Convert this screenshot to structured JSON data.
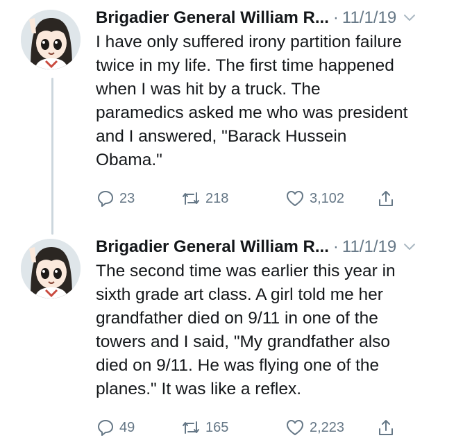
{
  "tweets": [
    {
      "author": "Brigadier General William R...",
      "separator": "·",
      "date": "11/1/19",
      "text": "I have only suffered irony partition failure\ntwice in my life. The first time happened\nwhen I was hit by a truck. The\nparamedics asked me who was president\nand I answered, \"Barack Hussein\nObama.\"",
      "replies": "23",
      "retweets": "218",
      "likes": "3,102"
    },
    {
      "author": "Brigadier General William R...",
      "separator": "·",
      "date": "11/1/19",
      "text": "The second time was earlier this year in\nsixth grade art class. A girl told me her\ngrandfather died on 9/11 in one of the\ntowers and I said, \"My grandfather also\ndied on 9/11. He was flying one of the\nplanes.\" It was like a reflex.",
      "replies": "49",
      "retweets": "165",
      "likes": "2,223"
    }
  ],
  "icons": {
    "reply": "speech-bubble-icon",
    "retweet": "retweet-arrows-icon",
    "like": "heart-icon",
    "share": "share-upload-icon",
    "more": "chevron-down-icon"
  },
  "colors": {
    "text": "#14171a",
    "muted": "#657786",
    "thread_line": "#ccd6dd"
  }
}
